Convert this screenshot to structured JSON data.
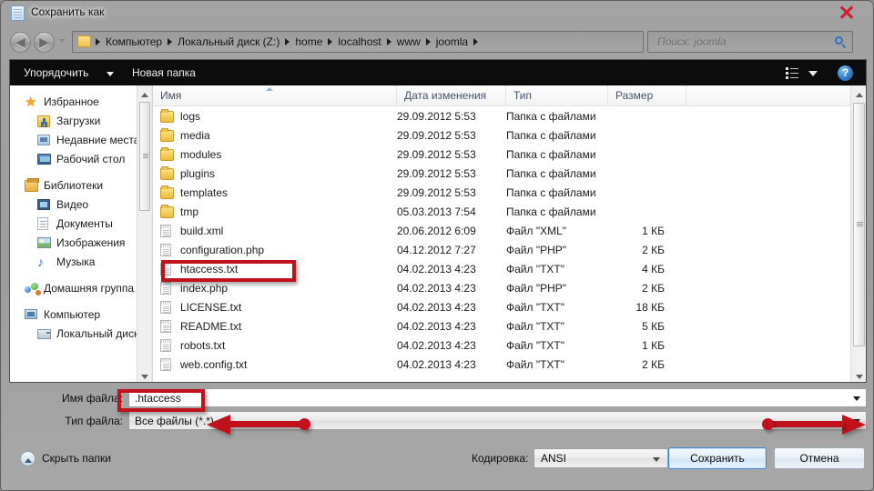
{
  "window": {
    "title": "Сохранить как",
    "title_icon": "notepad-document-icon",
    "close_label": "✕"
  },
  "addressbar": {
    "back_glyph": "◀",
    "forward_glyph": "▶",
    "folder_icon": "folder-icon",
    "crumbs": [
      "Компьютер",
      "Локальный диск (Z:)",
      "home",
      "localhost",
      "www",
      "joomla"
    ],
    "refresh_glyph": "↯",
    "search": {
      "placeholder": "Поиск: joomla",
      "value": ""
    }
  },
  "toolbar": {
    "organize_label": "Упорядочить",
    "new_folder_label": "Новая папка",
    "view_icon": "list-view-icon",
    "help_label": "?"
  },
  "sidebar": {
    "groups": [
      {
        "root": {
          "label": "Избранное",
          "icon": "star-icon"
        },
        "children": [
          {
            "label": "Загрузки",
            "icon": "downloads-icon"
          },
          {
            "label": "Недавние места",
            "icon": "recent-places-icon"
          },
          {
            "label": "Рабочий стол",
            "icon": "desktop-icon"
          }
        ]
      },
      {
        "root": {
          "label": "Библиотеки",
          "icon": "libraries-icon"
        },
        "children": [
          {
            "label": "Видео",
            "icon": "video-icon"
          },
          {
            "label": "Документы",
            "icon": "documents-icon"
          },
          {
            "label": "Изображения",
            "icon": "pictures-icon"
          },
          {
            "label": "Музыка",
            "icon": "music-icon"
          }
        ]
      },
      {
        "root": {
          "label": "Домашняя группа",
          "icon": "homegroup-icon"
        },
        "children": []
      },
      {
        "root": {
          "label": "Компьютер",
          "icon": "computer-icon"
        },
        "children": [
          {
            "label": "Локальный диск",
            "icon": "drive-icon"
          }
        ]
      }
    ]
  },
  "filelist": {
    "columns": [
      "Имя",
      "Дата изменения",
      "Тип",
      "Размер"
    ],
    "sorted_column": "Имя",
    "sort_direction": "ascending",
    "rows": [
      {
        "name": "logs",
        "date": "29.09.2012 5:53",
        "type": "Папка с файлами",
        "size": "",
        "icon": "folder-icon",
        "selected": false
      },
      {
        "name": "media",
        "date": "29.09.2012 5:53",
        "type": "Папка с файлами",
        "size": "",
        "icon": "folder-icon",
        "selected": false
      },
      {
        "name": "modules",
        "date": "29.09.2012 5:53",
        "type": "Папка с файлами",
        "size": "",
        "icon": "folder-icon",
        "selected": false
      },
      {
        "name": "plugins",
        "date": "29.09.2012 5:53",
        "type": "Папка с файлами",
        "size": "",
        "icon": "folder-icon",
        "selected": false
      },
      {
        "name": "templates",
        "date": "29.09.2012 5:53",
        "type": "Папка с файлами",
        "size": "",
        "icon": "folder-icon",
        "selected": false
      },
      {
        "name": "tmp",
        "date": "05.03.2013 7:54",
        "type": "Папка с файлами",
        "size": "",
        "icon": "folder-icon",
        "selected": false
      },
      {
        "name": "build.xml",
        "date": "20.06.2012 6:09",
        "type": "Файл \"XML\"",
        "size": "1 КБ",
        "icon": "file-icon",
        "selected": false
      },
      {
        "name": "configuration.php",
        "date": "04.12.2012 7:27",
        "type": "Файл \"PHP\"",
        "size": "2 КБ",
        "icon": "file-icon",
        "selected": false
      },
      {
        "name": "htaccess.txt",
        "date": "04.02.2013 4:23",
        "type": "Файл \"TXT\"",
        "size": "4 КБ",
        "icon": "file-icon",
        "selected": true
      },
      {
        "name": "index.php",
        "date": "04.02.2013 4:23",
        "type": "Файл \"PHP\"",
        "size": "2 КБ",
        "icon": "file-icon",
        "selected": false
      },
      {
        "name": "LICENSE.txt",
        "date": "04.02.2013 4:23",
        "type": "Файл \"TXT\"",
        "size": "18 КБ",
        "icon": "file-icon",
        "selected": false
      },
      {
        "name": "README.txt",
        "date": "04.02.2013 4:23",
        "type": "Файл \"TXT\"",
        "size": "5 КБ",
        "icon": "file-icon",
        "selected": false
      },
      {
        "name": "robots.txt",
        "date": "04.02.2013 4:23",
        "type": "Файл \"TXT\"",
        "size": "1 КБ",
        "icon": "file-icon",
        "selected": false
      },
      {
        "name": "web.config.txt",
        "date": "04.02.2013 4:23",
        "type": "Файл \"TXT\"",
        "size": "2 КБ",
        "icon": "file-icon",
        "selected": false
      }
    ]
  },
  "fields": {
    "filename_label": "Имя файла:",
    "filename_value": ".htaccess",
    "filetype_label": "Тип файла:",
    "filetype_value": "Все файлы  (*.*)"
  },
  "footer": {
    "hide_folders_label": "Скрыть папки",
    "encoding_label": "Кодировка:",
    "encoding_value": "ANSI",
    "save_label": "Сохранить",
    "cancel_label": "Отмена"
  },
  "annotations": {
    "accent_color": "#c1121c",
    "box_on_file_row": "htaccess.txt",
    "box_on_filename_field": ".htaccess",
    "arrow_left_target": "Все файлы  (*.*)",
    "arrow_right_target": "filetype-dropdown-caret",
    "close_x_marker": "✕"
  }
}
